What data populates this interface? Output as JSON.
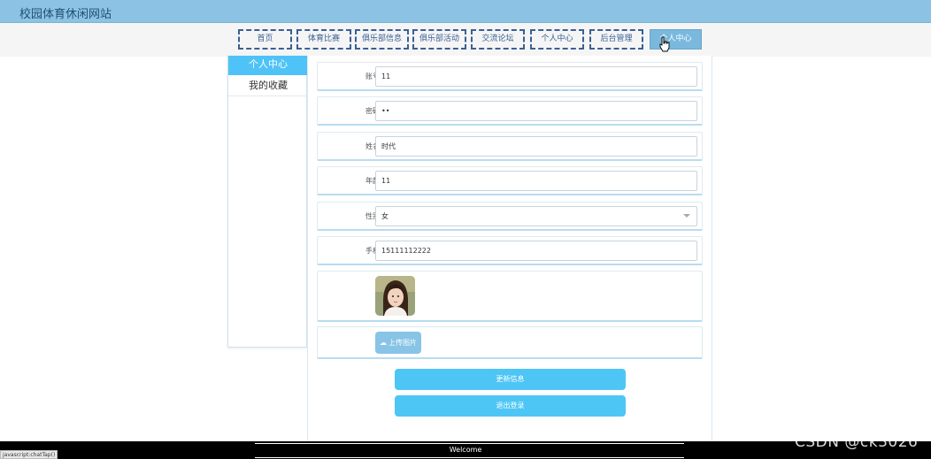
{
  "site": {
    "title": "校园体育休闲网站"
  },
  "nav": [
    {
      "label": "首页"
    },
    {
      "label": "体育比赛"
    },
    {
      "label": "俱乐部信息"
    },
    {
      "label": "俱乐部活动"
    },
    {
      "label": "交流论坛"
    },
    {
      "label": "个人中心"
    },
    {
      "label": "后台管理"
    },
    {
      "label": "个人中心"
    }
  ],
  "sidebar": {
    "items": [
      {
        "label": "个人中心"
      },
      {
        "label": "我的收藏"
      }
    ]
  },
  "form": {
    "account": {
      "label": "账号",
      "value": "11"
    },
    "password": {
      "label": "密码",
      "value": "••"
    },
    "name": {
      "label": "姓名",
      "value": "时代"
    },
    "age": {
      "label": "年龄",
      "value": "11"
    },
    "gender": {
      "label": "性别",
      "value": "女"
    },
    "phone": {
      "label": "手机",
      "value": "15111112222"
    }
  },
  "upload": {
    "label": "上传图片",
    "icon": "cloud-upload-icon"
  },
  "buttons": {
    "update": "更新信息",
    "logout": "退出登录"
  },
  "footer": {
    "text": "Welcome"
  },
  "status": {
    "url": "javascript:chatTap()"
  },
  "watermark": "CSDN @ck3026",
  "colors": {
    "topbar": "#8cc3e4",
    "accent": "#4ec6f5",
    "nav_border": "#3b5f95"
  }
}
